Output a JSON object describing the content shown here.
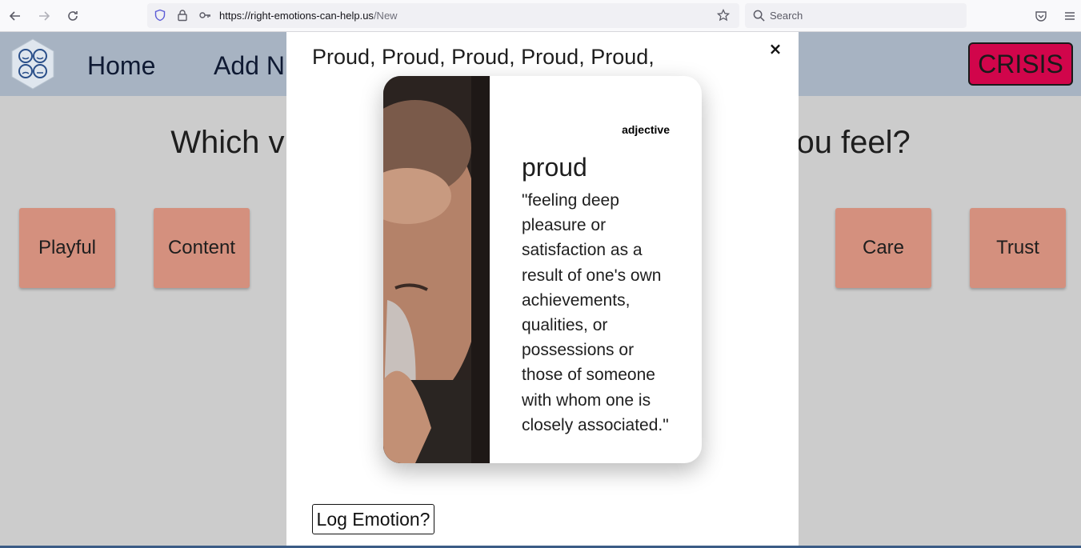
{
  "browser": {
    "url_host": "https://right-emotions-can-help.us",
    "url_path": "/New",
    "search_placeholder": "Search",
    "icons": [
      "back-icon",
      "forward-icon",
      "reload-icon",
      "shield-icon",
      "lock-icon",
      "key-icon",
      "bookmark-star-icon",
      "search-icon",
      "pocket-icon",
      "menu-icon"
    ]
  },
  "nav": {
    "home_label": "Home",
    "add_label": "Add N",
    "crisis_label": "CRISIS",
    "crisis_color": "#d1054b",
    "nav_bg": "#a7b3c2"
  },
  "page": {
    "question_left": "Which v",
    "question_right": "ou feel?",
    "emotions": [
      {
        "label": "Playful"
      },
      {
        "label": "Content"
      },
      {
        "label": "Care"
      },
      {
        "label": "Trust"
      }
    ],
    "emotion_color": "#d4907e"
  },
  "modal": {
    "title": "Proud, Proud, Proud, Proud, Proud,",
    "close_label": "×",
    "card": {
      "part_of_speech": "adjective",
      "word": "proud",
      "definition": "\"feeling deep pleasure or satisfaction as a result of one's own achievements, qualities, or possessions or those of someone with whom one is closely associated.\""
    },
    "log_button": "Log Emotion?"
  }
}
